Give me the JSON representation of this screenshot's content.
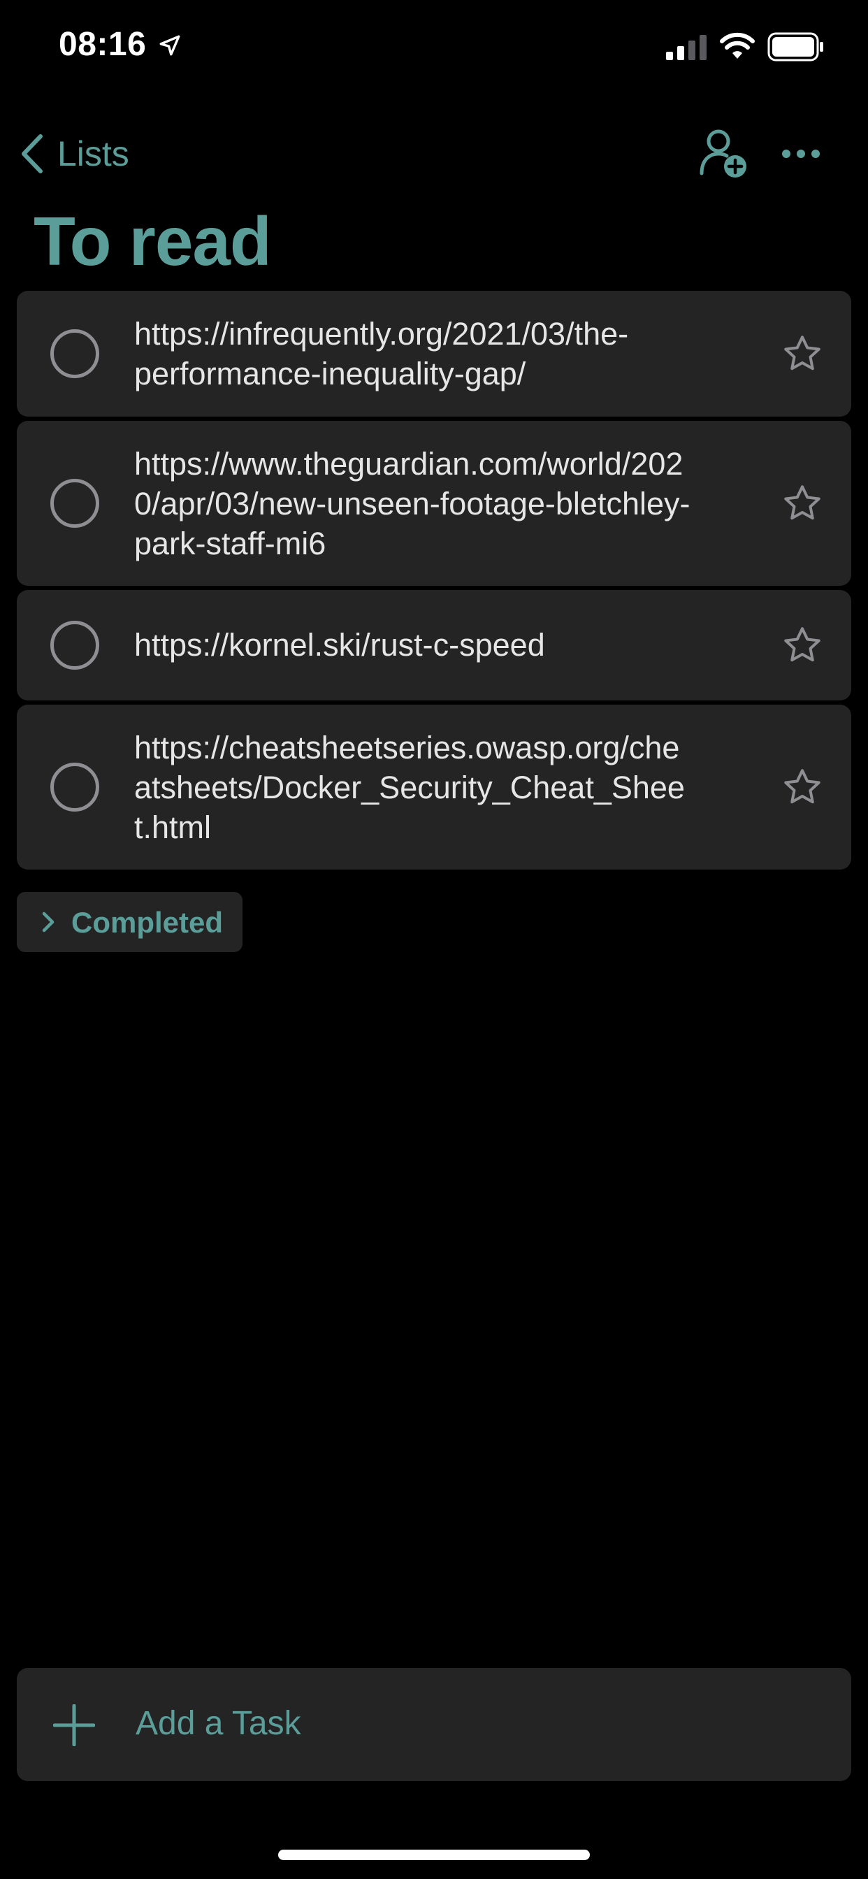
{
  "status_bar": {
    "time": "08:16",
    "icons": [
      "location-arrow-icon",
      "cellular-signal-icon",
      "wifi-icon",
      "battery-icon"
    ]
  },
  "nav": {
    "back_label": "Lists",
    "icons": [
      "chevron-left-icon",
      "share-person-plus-icon",
      "more-ellipsis-icon"
    ]
  },
  "page": {
    "title": "To read"
  },
  "tasks": [
    {
      "text": "https://infrequently.org/2021/03/the-performance-inequality-gap/",
      "completed": false,
      "starred": false
    },
    {
      "text": "https://www.theguardian.com/world/2020/apr/03/new-unseen-footage-bletchley-park-staff-mi6",
      "completed": false,
      "starred": false
    },
    {
      "text": "https://kornel.ski/rust-c-speed",
      "completed": false,
      "starred": false
    },
    {
      "text": "https://cheatsheetseries.owasp.org/cheatsheets/Docker_Security_Cheat_Sheet.html",
      "completed": false,
      "starred": false
    }
  ],
  "completed_section": {
    "label": "Completed"
  },
  "add_task": {
    "label": "Add a Task"
  },
  "colors": {
    "accent": "#5b9e99",
    "background": "#000000",
    "card": "#242424",
    "text": "#e6e6e6",
    "muted": "#8e8e93"
  }
}
